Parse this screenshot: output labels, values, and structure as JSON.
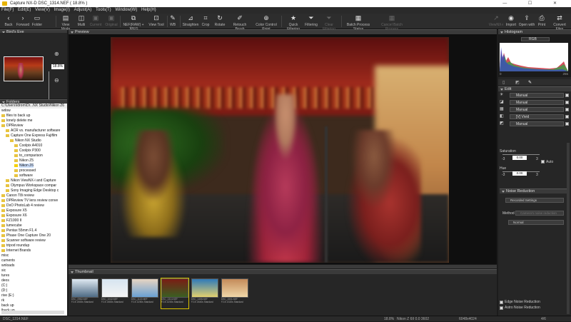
{
  "window": {
    "title": "Capture NX-D    DSC_1314.NEF ( 18.8% )"
  },
  "menu": [
    "File(F)",
    "Edit(E)",
    "View(V)",
    "Image(I)",
    "Adjust(A)",
    "Tools(T)",
    "Window(W)",
    "Help(H)"
  ],
  "toolbar": {
    "back": "Back",
    "forward": "Forward",
    "folder": "Folder",
    "view_mode": "View Mode",
    "multi": "Multi",
    "current": "Current",
    "original": "Original",
    "nef_jpeg": "NEF(RAW) + JPEG",
    "view_tool": "View Tool",
    "wb": "WB",
    "straighten": "Straighten",
    "crop": "Crop",
    "rotate": "Rotate",
    "retouch": "Retouch Brush",
    "ccp": "Color Control Point",
    "quick_filtering": "Quick Filtering",
    "filtering": "Filtering",
    "clear_filtering": "Clear Filtering",
    "batch_status": "Batch Process Status",
    "cancel_batch": "Cancel Batch Process",
    "viewnx": "ViewNX-i",
    "import": "Import",
    "open_with": "Open with",
    "print": "Print",
    "convert": "Convert Files"
  },
  "birds_eye": {
    "title": "Bird's Eye",
    "zoom_value": "18.8%"
  },
  "folders": {
    "title": "Folders",
    "path": "C:\\Users\\Idrom\\Dr...NX Studio\\Nikon Z6",
    "items": [
      {
        "label": "wdow",
        "indent": 0,
        "folder": false
      },
      {
        "label": "files to back up",
        "indent": 0,
        "folder": true
      },
      {
        "label": "lonely delete me",
        "indent": 0,
        "folder": true
      },
      {
        "label": "DPReview",
        "indent": 0,
        "folder": true
      },
      {
        "label": "ACR vs. manufacturer software",
        "indent": 1,
        "folder": true
      },
      {
        "label": "Capture One Express Fujifilm",
        "indent": 1,
        "folder": true
      },
      {
        "label": "Nikon NX Studio",
        "indent": 2,
        "folder": true
      },
      {
        "label": "Coolpix A4010",
        "indent": 3,
        "folder": true
      },
      {
        "label": "Coolpix P300",
        "indent": 3,
        "folder": true
      },
      {
        "label": "to_comparison",
        "indent": 3,
        "folder": true
      },
      {
        "label": "Nikon Z5",
        "indent": 3,
        "folder": true
      },
      {
        "label": "Nikon Z6",
        "indent": 3,
        "folder": true,
        "selected": true
      },
      {
        "label": "processed",
        "indent": 3,
        "folder": true
      },
      {
        "label": "software",
        "indent": 3,
        "folder": true
      },
      {
        "label": "Nikon ViewNX-i and Capture",
        "indent": 1,
        "folder": true
      },
      {
        "label": "Olympus Workspace compar",
        "indent": 1,
        "folder": true
      },
      {
        "label": "Sony Imaging Edge Desktop c",
        "indent": 1,
        "folder": true
      },
      {
        "label": "Canon T8i review",
        "indent": 0,
        "folder": true
      },
      {
        "label": "DPReview TV lens review conve",
        "indent": 0,
        "folder": true
      },
      {
        "label": "DxO PhotoLab 4 review",
        "indent": 0,
        "folder": true
      },
      {
        "label": "Exposure X5",
        "indent": 0,
        "folder": true
      },
      {
        "label": "Exposure X6",
        "indent": 0,
        "folder": true
      },
      {
        "label": "FZ1000 II",
        "indent": 0,
        "folder": true
      },
      {
        "label": "lumecube",
        "indent": 0,
        "folder": true
      },
      {
        "label": "Pentax 55mm F1.4",
        "indent": 0,
        "folder": true
      },
      {
        "label": "Phase One Capture One 20",
        "indent": 0,
        "folder": true
      },
      {
        "label": "Scanner software review",
        "indent": 0,
        "folder": true
      },
      {
        "label": "tripod roundup",
        "indent": 0,
        "folder": true
      },
      {
        "label": "Internet Brands",
        "indent": 0,
        "folder": true
      },
      {
        "label": "misc",
        "indent": 0,
        "folder": false
      },
      {
        "label": "cuments",
        "indent": 0,
        "folder": false
      },
      {
        "label": "wnloads",
        "indent": 0,
        "folder": false
      },
      {
        "label": "sic",
        "indent": 0,
        "folder": false
      },
      {
        "label": "tures",
        "indent": 0,
        "folder": false
      },
      {
        "label": "deos",
        "indent": 0,
        "folder": false
      },
      {
        "label": "(C:)",
        "indent": 0,
        "folder": false
      },
      {
        "label": "(D:)",
        "indent": 0,
        "folder": false
      },
      {
        "label": "rive (E:)",
        "indent": 0,
        "folder": false
      },
      {
        "label": "rk",
        "indent": 0,
        "folder": false
      },
      {
        "label": "back up",
        "indent": 0,
        "folder": false
      },
      {
        "label": "lback up",
        "indent": 0,
        "folder": false
      }
    ]
  },
  "viewer": {
    "title": "Preview"
  },
  "thumbnails": {
    "title": "Thumbnail",
    "items": [
      {
        "caption": "DSC_0982.NEF\nF2.8 1/500s Standard",
        "c1": "#dfe9f2",
        "c2": "#4d6a84",
        "selected": false
      },
      {
        "caption": "DSC_1042.NEF\nF2.8 1/800s Standard",
        "c1": "#d6e4f0",
        "c2": "#f4f4f4",
        "selected": false
      },
      {
        "caption": "DSC_1122.NEF\nF2.8 1/250s Standard",
        "c1": "#e7d4c2",
        "c2": "#6aa0d2",
        "selected": false
      },
      {
        "caption": "DSC_1314.NEF\nF2.8 1/200s Standard",
        "c1": "#7a1e14",
        "c2": "#3a5f22",
        "selected": true
      },
      {
        "caption": "DSC_1455.NEF\nF2.8 1/640s Standard",
        "c1": "#2f7ab8",
        "c2": "#e2d06e",
        "selected": false
      },
      {
        "caption": "DSC_1501.NEF\nF2.8 1/320s Standard",
        "c1": "#c48b5a",
        "c2": "#f0d7a8",
        "selected": false
      }
    ]
  },
  "histogram": {
    "title": "Histogram",
    "channel": "RGB",
    "min": "0",
    "max": "255"
  },
  "edit": {
    "title": "Edit",
    "rows": [
      {
        "icon": "☀",
        "value": "Manual"
      },
      {
        "icon": "◪",
        "value": "Manual"
      },
      {
        "icon": "▦",
        "value": "Manual"
      },
      {
        "icon": "◧",
        "value": "[V] Vivid"
      },
      {
        "icon": "◩",
        "value": "Manual"
      }
    ],
    "saturation_label": "Saturation",
    "saturation_value": "0.00",
    "auto_label": "Auto",
    "hue_label": "Hue",
    "hue_value": "0.00",
    "neg_tick": "-3",
    "pos_tick": "3"
  },
  "noise": {
    "title": "Noise Reduction",
    "recorded": "Recorded Settings",
    "method_label": "Method",
    "method_value": "Camera's noise reduction",
    "strength": "Normal",
    "edge_nr": "Edge Noise Reduction",
    "astro_nr": "Astro Noise Reduction"
  },
  "status": {
    "file": "DSC_1314.NEF",
    "zoom": "18.8%",
    "camera": "Nikon Z 6II 0.0 3602",
    "dims": "6048x4024",
    "page": "4/6"
  }
}
